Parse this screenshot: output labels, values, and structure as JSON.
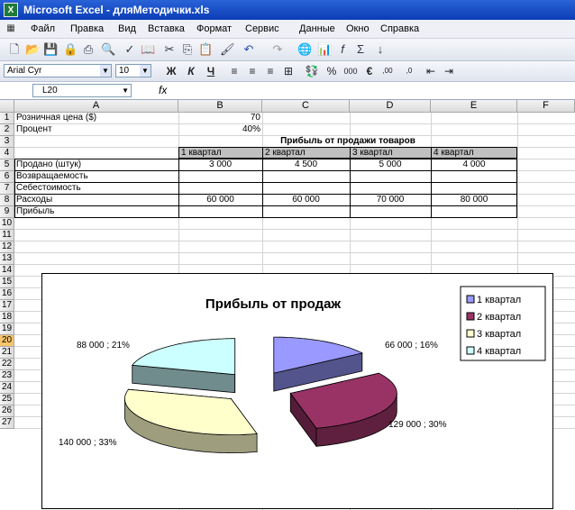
{
  "window": {
    "title": "Microsoft Excel - дляМетодички.xls"
  },
  "menu": [
    "Файл",
    "Правка",
    "Вид",
    "Вставка",
    "Формат",
    "Сервис",
    "Данные",
    "Окно",
    "Справка"
  ],
  "format_bar": {
    "font": "Arial Cyr",
    "size": "10"
  },
  "formula_bar": {
    "cell_ref": "L20",
    "fx_icon": "fx-icon"
  },
  "columns": [
    "A",
    "B",
    "C",
    "D",
    "E",
    "F"
  ],
  "rows": [
    "1",
    "2",
    "3",
    "4",
    "5",
    "6",
    "7",
    "8",
    "9",
    "10",
    "11",
    "12",
    "13",
    "14",
    "15",
    "16",
    "17",
    "18",
    "19",
    "20",
    "21",
    "22",
    "23",
    "24",
    "25",
    "26",
    "27"
  ],
  "selected_row": "20",
  "cells": {
    "a1": "Розничная цена ($)",
    "b1": "70",
    "a2": "Процент",
    "b2": "40%",
    "title3": "Прибыль от продажи товаров",
    "b4": "1 квартал",
    "c4": "2 квартал",
    "d4": "3 квартал",
    "e4": "4 квартал",
    "a5": "Продано (штук)",
    "b5": "3 000",
    "c5": "4 500",
    "d5": "5 000",
    "e5": "4 000",
    "a6": "Возвращаемость",
    "a7": "Себестоимость",
    "a8": "Расходы",
    "b8": "60 000",
    "c8": "60 000",
    "d8": "70 000",
    "e8": "80 000",
    "a9": "Прибыль"
  },
  "chart_data": {
    "type": "pie",
    "title": "Прибыль от продаж",
    "categories": [
      "1 квартал",
      "2 квартал",
      "3 квартал",
      "4 квартал"
    ],
    "values": [
      66000,
      129000,
      140000,
      88000
    ],
    "labels": [
      "66 000  ; 16%",
      "129 000  ; 30%",
      "140 000  ; 33%",
      "88 000  ; 21%"
    ],
    "colors": [
      "#9999ff",
      "#993366",
      "#ffffcc",
      "#ccffff"
    ],
    "legend_position": "right",
    "exploded": true,
    "three_d": true
  }
}
